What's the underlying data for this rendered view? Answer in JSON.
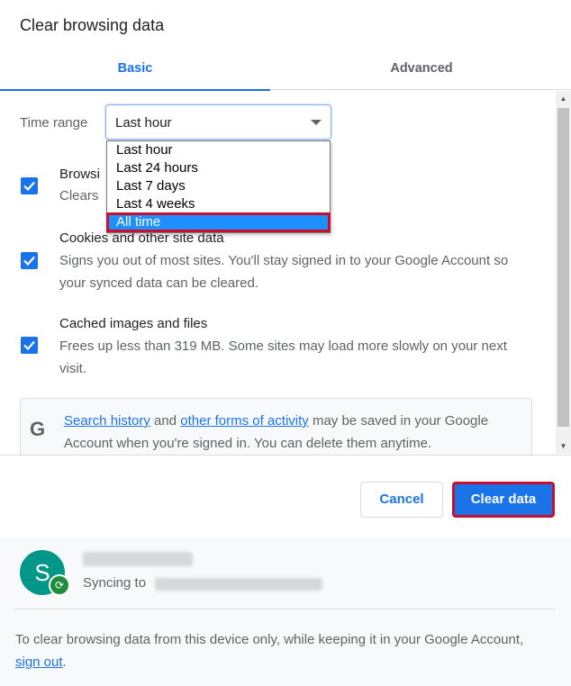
{
  "dialog": {
    "title": "Clear browsing data"
  },
  "tabs": [
    {
      "label": "Basic",
      "active": true
    },
    {
      "label": "Advanced",
      "active": false
    }
  ],
  "time_range": {
    "label": "Time range",
    "value": "Last hour",
    "options": [
      "Last hour",
      "Last 24 hours",
      "Last 7 days",
      "Last 4 weeks",
      "All time"
    ],
    "highlighted_option": "All time"
  },
  "items": [
    {
      "title": "Browsi",
      "description": "Clears",
      "checked": true
    },
    {
      "title": "Cookies and other site data",
      "description": "Signs you out of most sites. You'll stay signed in to your Google Account so your synced data can be cleared.",
      "checked": true
    },
    {
      "title": "Cached images and files",
      "description": "Frees up less than 319 MB. Some sites may load more slowly on your next visit.",
      "checked": true
    }
  ],
  "info": {
    "icon": "google-g-icon",
    "link1": "Search history",
    "text1": " and ",
    "link2": "other forms of activity",
    "text2": " may be saved in your Google Account when you're signed in. You can delete them anytime."
  },
  "buttons": {
    "cancel": "Cancel",
    "clear": "Clear data"
  },
  "account": {
    "avatar_letter": "S",
    "syncing_label": "Syncing to",
    "footer_text": "To clear browsing data from this device only, while keeping it in your Google Account, ",
    "sign_out": "sign out",
    "footer_end": "."
  },
  "colors": {
    "accent": "#1a73e8",
    "highlight_border": "#c8102e",
    "avatar": "#009688",
    "sync_badge": "#1e8e3e"
  }
}
